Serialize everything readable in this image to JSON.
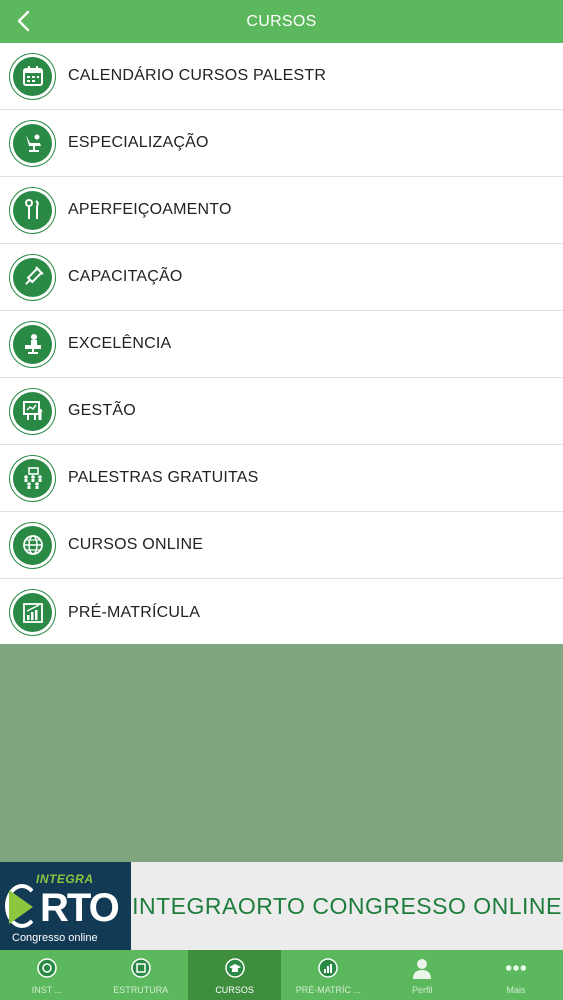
{
  "header": {
    "title": "CURSOS",
    "back_icon": "chevron-left-icon"
  },
  "menu": {
    "items": [
      {
        "label": "CALENDÁRIO CURSOS PALESTR",
        "icon": "calendar-icon"
      },
      {
        "label": "ESPECIALIZAÇÃO",
        "icon": "dental-chair-icon"
      },
      {
        "label": "APERFEIÇOAMENTO",
        "icon": "dental-tools-icon"
      },
      {
        "label": "CAPACITAÇÃO",
        "icon": "syringe-icon"
      },
      {
        "label": "EXCELÊNCIA",
        "icon": "patient-chair-icon"
      },
      {
        "label": "GESTÃO",
        "icon": "presentation-icon"
      },
      {
        "label": "PALESTRAS GRATUITAS",
        "icon": "audience-icon"
      },
      {
        "label": "CURSOS ONLINE",
        "icon": "globe-icon"
      },
      {
        "label": "PRÉ-MATRÍCULA",
        "icon": "chart-icon"
      }
    ]
  },
  "banner": {
    "logo_top": "INTEGRA",
    "logo_main": "RTO",
    "logo_sub": "Congresso online",
    "text": "INTEGRAORTO CONGRESSO ONLINE"
  },
  "tabbar": {
    "tabs": [
      {
        "label": "INST ...",
        "icon": "institution-icon",
        "active": false
      },
      {
        "label": "ESTRUTURA",
        "icon": "structure-icon",
        "active": false
      },
      {
        "label": "CURSOS",
        "icon": "graduation-cap-icon",
        "active": true
      },
      {
        "label": "PRÉ-MATRÍC ...",
        "icon": "chart-icon",
        "active": false
      },
      {
        "label": "Perfil",
        "icon": "user-icon",
        "active": false
      },
      {
        "label": "Mais",
        "icon": "more-icon",
        "active": false
      }
    ]
  },
  "colors": {
    "primary": "#5cb85c",
    "primary_dark": "#3e8e3e",
    "icon_bg": "#2a8a45",
    "background": "#7fa67f",
    "banner_text": "#1e7d3c"
  }
}
